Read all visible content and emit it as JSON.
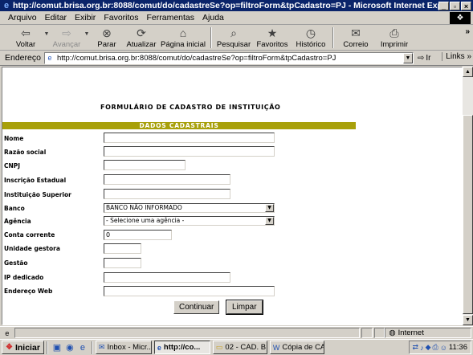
{
  "window": {
    "title": "http://comut.brisa.org.br:8088/comut/do/cadastreSe?op=filtroForm&tpCadastro=PJ - Microsoft Internet Explorer",
    "controls": [
      "_",
      "▫",
      "×"
    ]
  },
  "menu": {
    "items": [
      "Arquivo",
      "Editar",
      "Exibir",
      "Favoritos",
      "Ferramentas",
      "Ajuda"
    ]
  },
  "toolbar": {
    "buttons": [
      {
        "label": "Voltar",
        "icon": "back-arrow-icon",
        "glyph": "⇦",
        "enabled": true
      },
      {
        "label": "Avançar",
        "icon": "forward-arrow-icon",
        "glyph": "⇨",
        "enabled": false
      },
      {
        "label": "Parar",
        "icon": "stop-icon",
        "glyph": "⊗",
        "enabled": true
      },
      {
        "label": "Atualizar",
        "icon": "refresh-icon",
        "glyph": "⟳",
        "enabled": true
      },
      {
        "label": "Página inicial",
        "icon": "home-icon",
        "glyph": "⌂",
        "enabled": true
      },
      {
        "label": "Pesquisar",
        "icon": "search-icon",
        "glyph": "⌕",
        "enabled": true
      },
      {
        "label": "Favoritos",
        "icon": "favorites-icon",
        "glyph": "★",
        "enabled": true
      },
      {
        "label": "Histórico",
        "icon": "history-icon",
        "glyph": "◷",
        "enabled": true
      },
      {
        "label": "Correio",
        "icon": "mail-icon",
        "glyph": "✉",
        "enabled": true
      },
      {
        "label": "Imprimir",
        "icon": "print-icon",
        "glyph": "⎙",
        "enabled": true
      }
    ],
    "more": "»"
  },
  "address": {
    "label": "Endereço",
    "url": "http://comut.brisa.org.br:8088/comut/do/cadastreSe?op=filtroForm&tpCadastro=PJ",
    "go_label": "Ir",
    "links_label": "Links"
  },
  "form": {
    "title": "FORMULÁRIO DE CADASTRO DE INSTITUIÇÃO",
    "section": "DADOS CADASTRAIS",
    "fields": {
      "nome": {
        "label": "Nome",
        "value": ""
      },
      "razao_social": {
        "label": "Razão social",
        "value": ""
      },
      "cnpj": {
        "label": "CNPJ",
        "value": ""
      },
      "inscricao_estadual": {
        "label": "Inscrição Estadual",
        "value": ""
      },
      "instituicao_superior": {
        "label": "Instituição Superior",
        "value": ""
      },
      "banco": {
        "label": "Banco",
        "value": "BANCO NÃO INFORMADO"
      },
      "agencia": {
        "label": "Agência",
        "value": "- Selecione uma agência -"
      },
      "conta_corrente": {
        "label": "Conta corrente",
        "value": "0"
      },
      "unidade_gestora": {
        "label": "Unidade gestora",
        "value": ""
      },
      "gestao": {
        "label": "Gestão",
        "value": ""
      },
      "ip_dedicado": {
        "label": "IP dedicado",
        "value": ""
      },
      "endereco_web": {
        "label": "Endereço Web",
        "value": ""
      }
    },
    "buttons": {
      "submit": "Continuar",
      "reset": "Limpar"
    }
  },
  "status": {
    "zone": "Internet"
  },
  "taskbar": {
    "start": "Iniciar",
    "tasks": [
      {
        "label": "Inbox - Micr...",
        "active": false
      },
      {
        "label": "http://co...",
        "active": true
      },
      {
        "label": "02 - CAD. BI...",
        "active": false
      },
      {
        "label": "Cópia de CA...",
        "active": false
      }
    ],
    "clock": "11:36"
  }
}
